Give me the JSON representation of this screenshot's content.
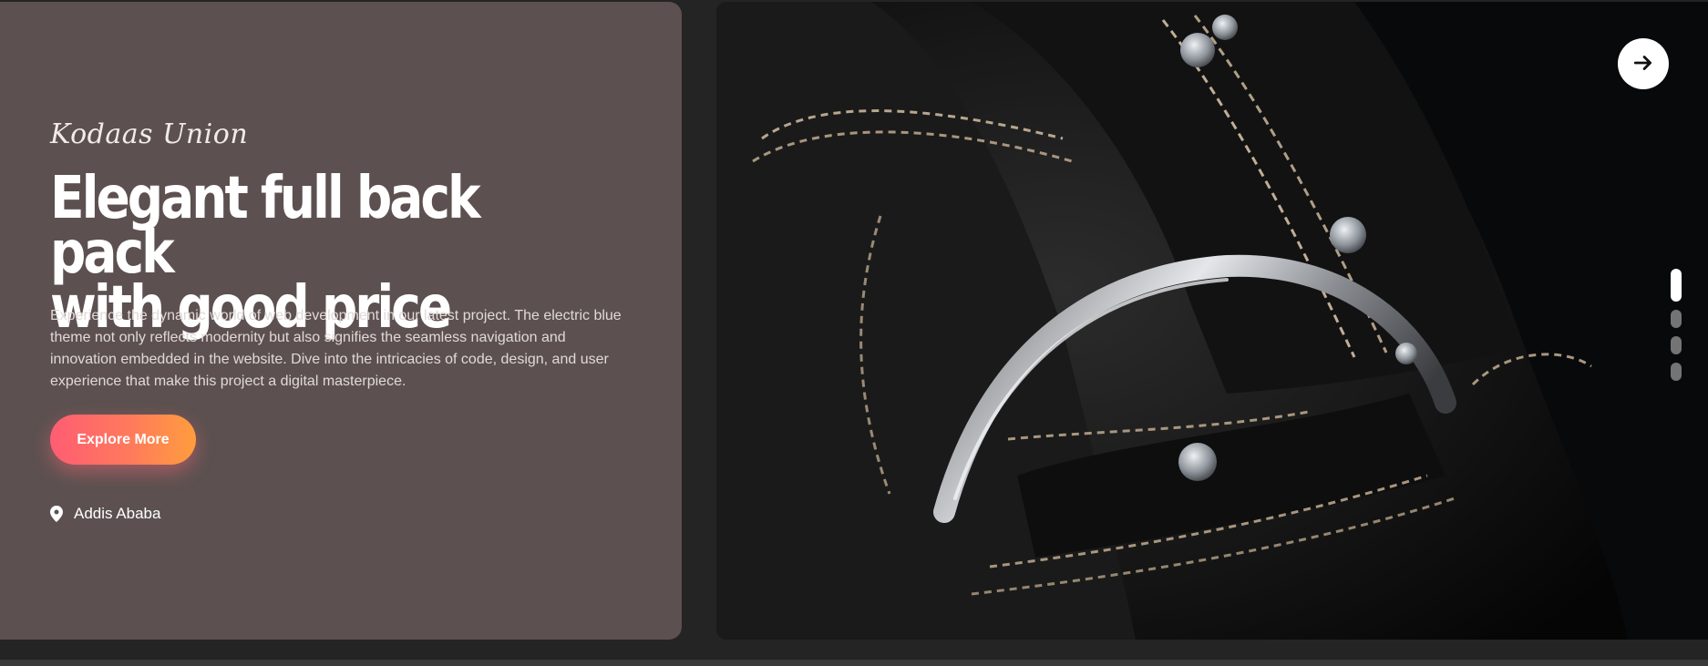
{
  "hero": {
    "brand": "Kodaas Union",
    "headline_line1": "Elegant full back pack",
    "headline_line2": "with good price",
    "description": "Experience the dynamic world of web development in our latest project. The electric blue theme not only reflects modernity but also signifies the seamless navigation and innovation embedded in the website. Dive into the intricacies of code, design, and user experience that make this project a digital masterpiece.",
    "cta_label": "Explore More",
    "location": "Addis Ababa"
  },
  "slider": {
    "slide_count": 4,
    "active_index": 0,
    "image_subject": "black leather backpack with metal ring buckle",
    "icons": {
      "next": "arrow-right-icon",
      "location": "location-pin-icon"
    }
  },
  "colors": {
    "page_background": "#242424",
    "card_background": "#5c5150",
    "cta_gradient_start": "#ff5d73",
    "cta_gradient_end": "#ff9d3d",
    "active_dot": "#ffffff",
    "inactive_dot": "#747474"
  }
}
